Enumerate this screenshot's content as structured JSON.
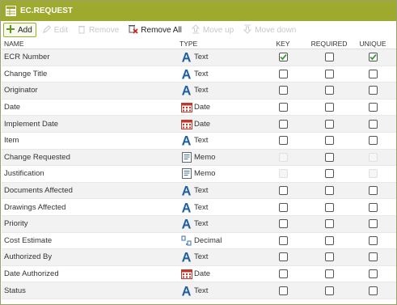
{
  "title": "EC.REQUEST",
  "toolbar": {
    "add": "Add",
    "edit": "Edit",
    "remove": "Remove",
    "remove_all": "Remove All",
    "move_up": "Move up",
    "move_down": "Move down"
  },
  "columns": {
    "name": "NAME",
    "type": "TYPE",
    "key": "KEY",
    "required": "REQUIRED",
    "unique": "UNIQUE"
  },
  "colors": {
    "titlebar": "#9eaa2e",
    "check": "#3a9a3a",
    "text_icon": "#1f5fa0",
    "date_icon": "#c0392b"
  },
  "rows": [
    {
      "name": "ECR Number",
      "type": "Text",
      "icon": "text-icon",
      "key": true,
      "key_enabled": true,
      "required": false,
      "required_enabled": true,
      "unique": true,
      "unique_enabled": true
    },
    {
      "name": "Change Title",
      "type": "Text",
      "icon": "text-icon",
      "key": false,
      "key_enabled": true,
      "required": false,
      "required_enabled": true,
      "unique": false,
      "unique_enabled": true
    },
    {
      "name": "Originator",
      "type": "Text",
      "icon": "text-icon",
      "key": false,
      "key_enabled": true,
      "required": false,
      "required_enabled": true,
      "unique": false,
      "unique_enabled": true
    },
    {
      "name": "Date",
      "type": "Date",
      "icon": "calendar-icon",
      "key": false,
      "key_enabled": true,
      "required": false,
      "required_enabled": true,
      "unique": false,
      "unique_enabled": true
    },
    {
      "name": "Implement Date",
      "type": "Date",
      "icon": "calendar-icon",
      "key": false,
      "key_enabled": true,
      "required": false,
      "required_enabled": true,
      "unique": false,
      "unique_enabled": true
    },
    {
      "name": "Item",
      "type": "Text",
      "icon": "text-icon",
      "key": false,
      "key_enabled": true,
      "required": false,
      "required_enabled": true,
      "unique": false,
      "unique_enabled": true
    },
    {
      "name": "Change Requested",
      "type": "Memo",
      "icon": "memo-icon",
      "key": false,
      "key_enabled": false,
      "required": false,
      "required_enabled": true,
      "unique": false,
      "unique_enabled": false
    },
    {
      "name": "Justification",
      "type": "Memo",
      "icon": "memo-icon",
      "key": false,
      "key_enabled": false,
      "required": false,
      "required_enabled": true,
      "unique": false,
      "unique_enabled": false
    },
    {
      "name": "Documents Affected",
      "type": "Text",
      "icon": "text-icon",
      "key": false,
      "key_enabled": true,
      "required": false,
      "required_enabled": true,
      "unique": false,
      "unique_enabled": true
    },
    {
      "name": "Drawings Affected",
      "type": "Text",
      "icon": "text-icon",
      "key": false,
      "key_enabled": true,
      "required": false,
      "required_enabled": true,
      "unique": false,
      "unique_enabled": true
    },
    {
      "name": "Priority",
      "type": "Text",
      "icon": "text-icon",
      "key": false,
      "key_enabled": true,
      "required": false,
      "required_enabled": true,
      "unique": false,
      "unique_enabled": true
    },
    {
      "name": "Cost Estimate",
      "type": "Decimal",
      "icon": "decimal-icon",
      "key": false,
      "key_enabled": true,
      "required": false,
      "required_enabled": true,
      "unique": false,
      "unique_enabled": true
    },
    {
      "name": "Authorized By",
      "type": "Text",
      "icon": "text-icon",
      "key": false,
      "key_enabled": true,
      "required": false,
      "required_enabled": true,
      "unique": false,
      "unique_enabled": true
    },
    {
      "name": "Date Authorized",
      "type": "Date",
      "icon": "calendar-icon",
      "key": false,
      "key_enabled": true,
      "required": false,
      "required_enabled": true,
      "unique": false,
      "unique_enabled": true
    },
    {
      "name": "Status",
      "type": "Text",
      "icon": "text-icon",
      "key": false,
      "key_enabled": true,
      "required": false,
      "required_enabled": true,
      "unique": false,
      "unique_enabled": true
    }
  ]
}
